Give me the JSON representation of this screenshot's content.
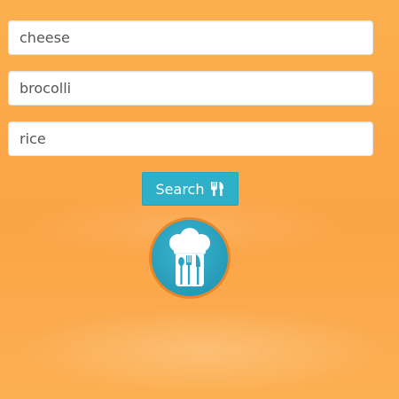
{
  "inputs": [
    {
      "value": "cheese"
    },
    {
      "value": "brocolli"
    },
    {
      "value": "rice"
    }
  ],
  "search_button": {
    "label": "Search",
    "icon": "cutlery-icon"
  },
  "logo": {
    "icon": "chef-hat-cutlery-icon"
  },
  "colors": {
    "background": "#fba846",
    "button": "#2fb0c9",
    "logo_ring": "#e8872a",
    "logo_fill": "#2ea8c4"
  }
}
